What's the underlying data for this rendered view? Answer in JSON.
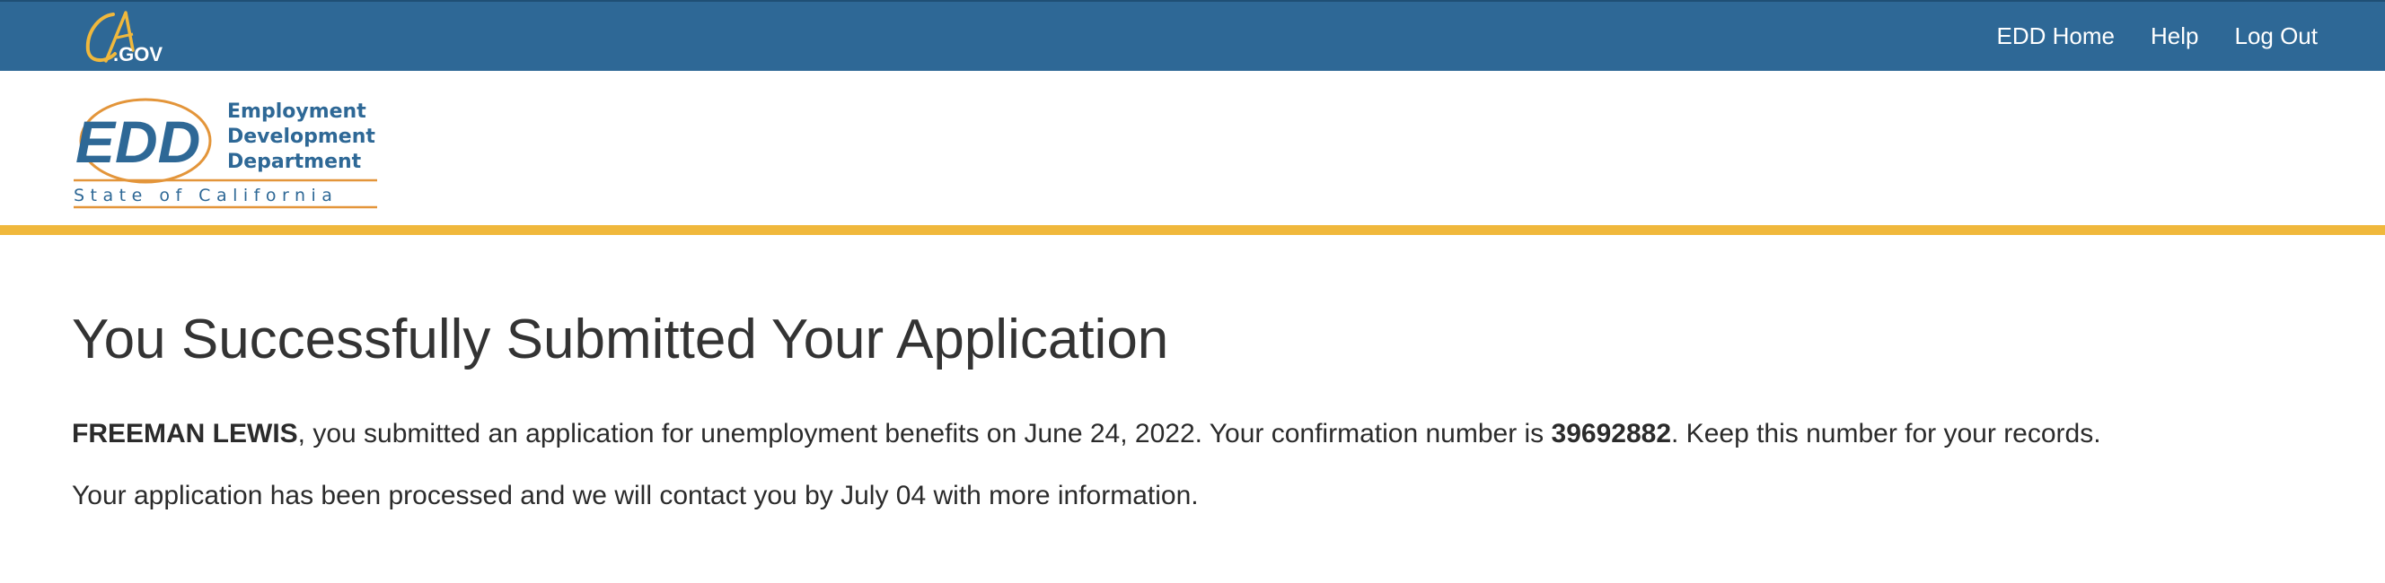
{
  "topbar": {
    "logo_text": "CA.GOV",
    "nav": [
      {
        "label": "EDD Home"
      },
      {
        "label": "Help"
      },
      {
        "label": "Log Out"
      }
    ],
    "background_color": "#2e6896"
  },
  "header": {
    "logo": {
      "abbr": "EDD",
      "line1": "Employment",
      "line2": "Development",
      "line3": "Department",
      "tagline": "State of California"
    },
    "rule_color": "#f0b83c"
  },
  "main": {
    "title": "You Successfully Submitted Your Application",
    "confirmation": {
      "name": "FREEMAN LEWIS",
      "text_before_number": ", you submitted an application for unemployment benefits on June 24, 2022. Your confirmation number is ",
      "number": "39692882",
      "text_after_number": ". Keep this number for your records."
    },
    "followup": "Your application has been processed and we will contact you by July 04 with more information."
  }
}
